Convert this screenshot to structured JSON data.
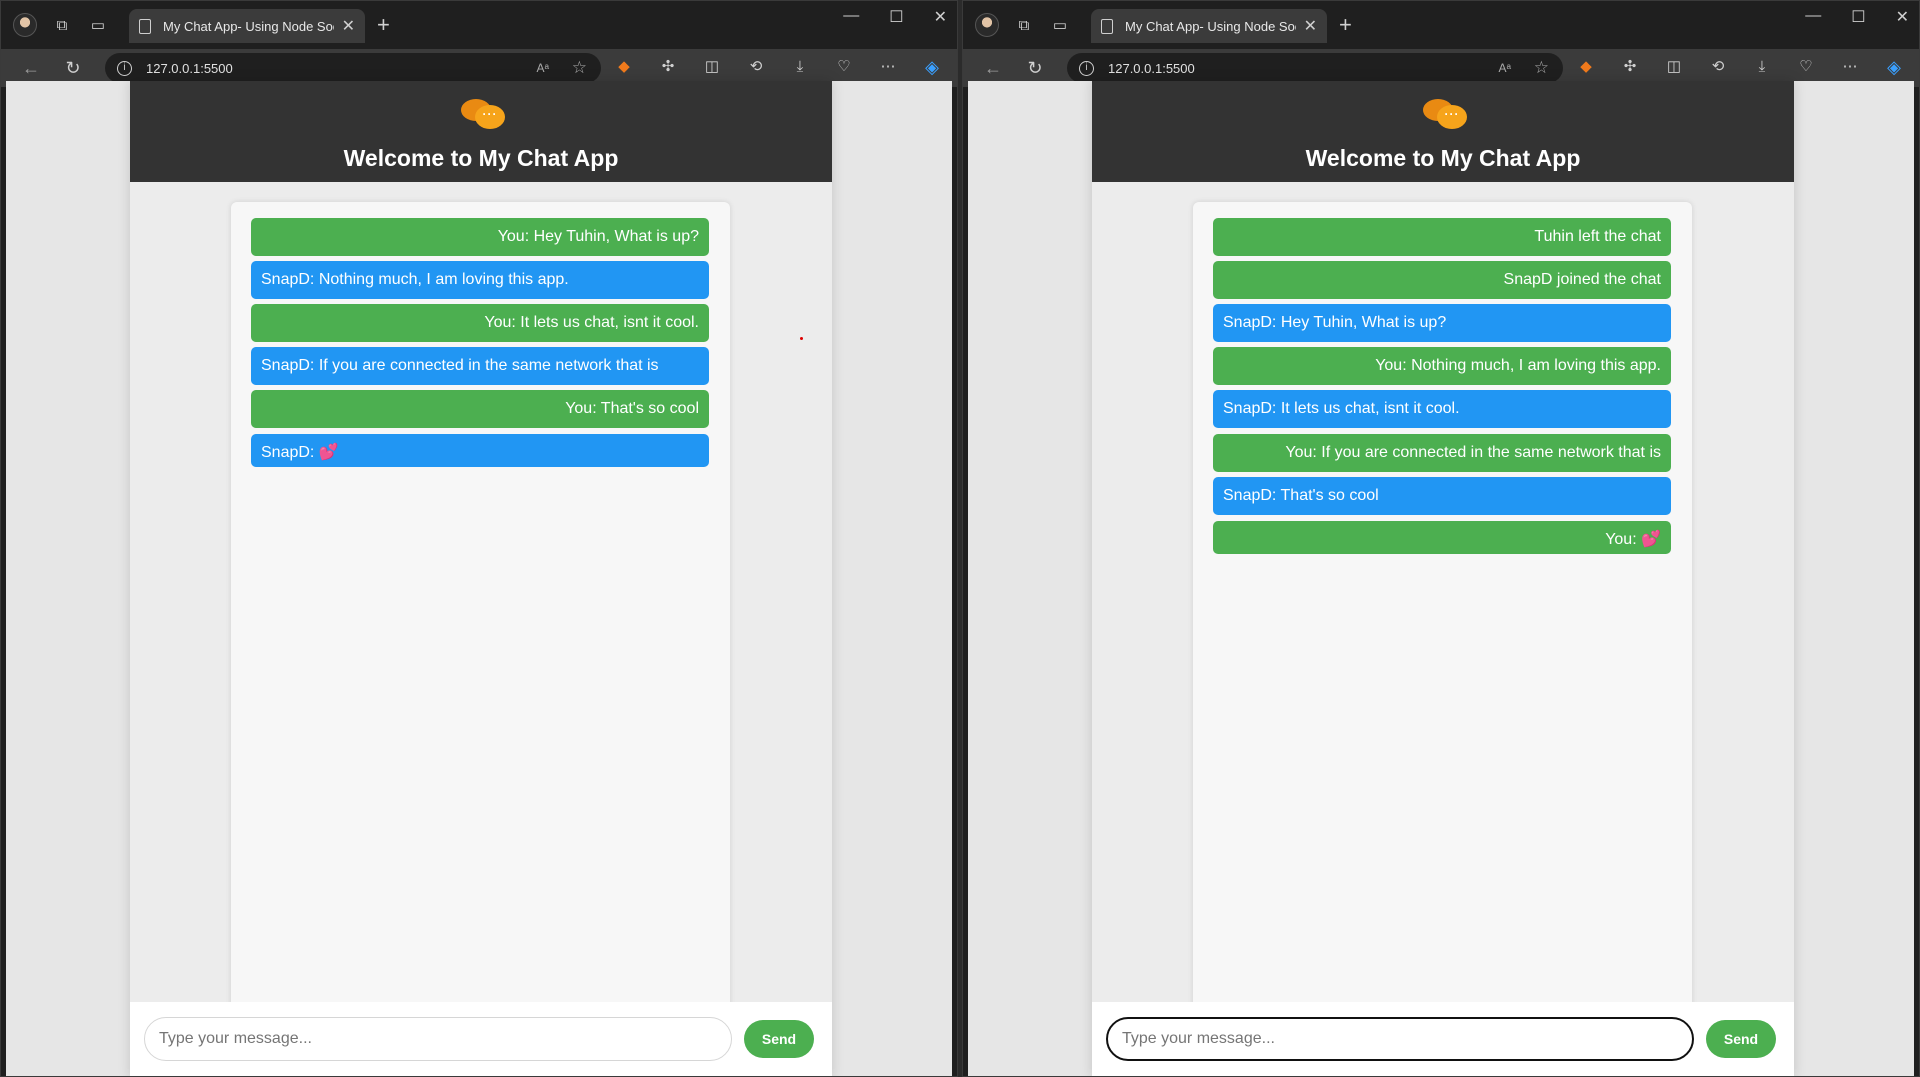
{
  "windows": [
    {
      "tab_title": "My Chat App- Using Node Socke",
      "url": "127.0.0.1:5500",
      "app_title": "Welcome to My Chat App",
      "input_placeholder": "Type your message...",
      "send_label": "Send",
      "messages": [
        {
          "type": "self",
          "text": "You: Hey Tuhin, What is up?"
        },
        {
          "type": "other",
          "text": "SnapD: Nothing much, I am loving this app."
        },
        {
          "type": "self",
          "text": "You: It lets us chat, isnt it cool."
        },
        {
          "type": "other",
          "text": "SnapD: If you are connected in the same network that is"
        },
        {
          "type": "self",
          "text": "You: That's so cool"
        },
        {
          "type": "other",
          "text": "SnapD: ",
          "emoji": "💕"
        }
      ]
    },
    {
      "tab_title": "My Chat App- Using Node Socke",
      "url": "127.0.0.1:5500",
      "app_title": "Welcome to My Chat App",
      "input_placeholder": "Type your message...",
      "send_label": "Send",
      "messages": [
        {
          "type": "self",
          "text": "Tuhin left the chat"
        },
        {
          "type": "self",
          "text": "SnapD joined the chat"
        },
        {
          "type": "other",
          "text": "SnapD: Hey Tuhin, What is up?"
        },
        {
          "type": "self",
          "text": "You: Nothing much, I am loving this app."
        },
        {
          "type": "other",
          "text": "SnapD: It lets us chat, isnt it cool."
        },
        {
          "type": "self",
          "text": "You: If you are connected in the same network that is"
        },
        {
          "type": "other",
          "text": "SnapD: That's so cool"
        },
        {
          "type": "self",
          "text": "You: ",
          "emoji": "💕"
        }
      ]
    }
  ],
  "colors": {
    "self_bubble": "#4caf50",
    "other_bubble": "#2196f3",
    "header_bg": "#333333",
    "send_button": "#4caf50"
  },
  "icons": {
    "tabbar": [
      "profile-avatar",
      "workspaces-icon",
      "tab-actions-icon"
    ],
    "toolbar": [
      "read-aloud-icon",
      "favorite-star-icon",
      "extension-icon",
      "extensions-icon",
      "split-screen-icon",
      "history-icon",
      "downloads-icon",
      "browser-essentials-icon",
      "more-icon",
      "copilot-icon"
    ],
    "window_controls": [
      "minimize-icon",
      "maximize-icon",
      "close-icon"
    ]
  }
}
